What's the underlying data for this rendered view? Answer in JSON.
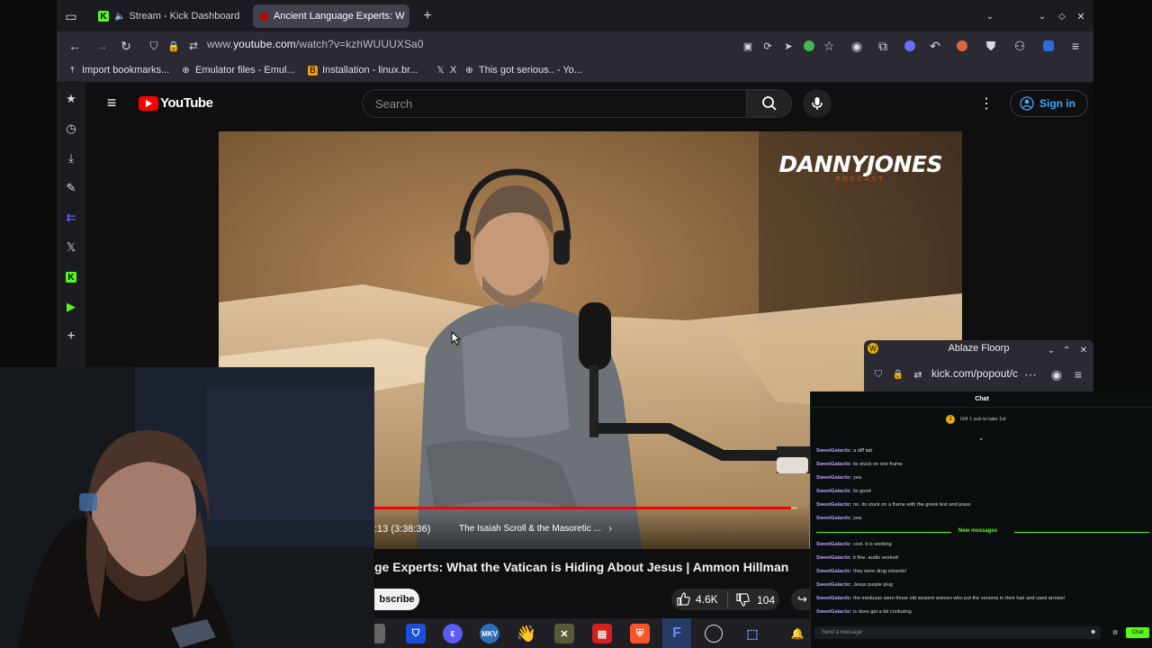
{
  "browser": {
    "tabs": [
      {
        "label": "Stream - Kick Dashboard",
        "favicon": "kick-icon",
        "active": false
      },
      {
        "label": "Ancient Language Experts: W",
        "favicon": "youtube-icon",
        "active": true
      }
    ],
    "url_prefix": "www.",
    "url_domain": "youtube.com",
    "url_rest": "/watch?v=kzhWUUUXSa0",
    "bookmarks": [
      {
        "label": "Import bookmarks...",
        "icon": "import-icon"
      },
      {
        "label": "Emulator files - Emul...",
        "icon": "globe-icon"
      },
      {
        "label": "Installation - linux.br...",
        "icon": "b-icon"
      },
      {
        "label": "X",
        "icon": "x-icon"
      },
      {
        "label": "This got serious.. - Yo...",
        "icon": "globe-icon"
      }
    ]
  },
  "youtube": {
    "logo_text": "YouTube",
    "search_placeholder": "Search",
    "sign_in": "Sign in",
    "video_logo": "DANNYJONES",
    "video_logo_sub": "PODCAST",
    "time_text": ":13 (3:38:36)",
    "chapter": "The Isaiah Scroll & the Masoretic ...",
    "progress_fraction": 0.985,
    "title": "ge Experts: What the Vatican is Hiding About Jesus | Ammon Hillman",
    "subscribe": "bscribe",
    "likes": "4.6K",
    "dislikes": "104"
  },
  "kick_popup": {
    "title": "Ablaze Floorp",
    "url": "kick.com/popout/c"
  },
  "chat": {
    "header": "Chat",
    "pinned": "Gift 1 sub to take 1st",
    "messages_before": [
      {
        "user": "SweetGalactic",
        "text": "a diff tab"
      },
      {
        "user": "SweetGalactic",
        "text": "its stuck on one frame"
      },
      {
        "user": "SweetGalactic",
        "text": "yea"
      },
      {
        "user": "SweetGalactic",
        "text": "its good"
      },
      {
        "user": "SweetGalactic",
        "text": "no. its stuck on a frame with the greek text and jesus"
      },
      {
        "user": "SweetGalactic",
        "text": "yea"
      }
    ],
    "new_messages_label": "New messages",
    "messages_after": [
      {
        "user": "SweetGalactic",
        "text": "cool. it is working"
      },
      {
        "user": "SweetGalactic",
        "text": "it fine. audio worked"
      },
      {
        "user": "SweetGalactic",
        "text": "they were drug wizards!"
      },
      {
        "user": "SweetGalactic",
        "text": "Jesus purple plug"
      },
      {
        "user": "SweetGalactic",
        "text": "the medusas were those old serpent women who put the venoms in their hair and used arrows!"
      },
      {
        "user": "SweetGalactic",
        "text": "is does get a bit confusing"
      }
    ],
    "input_placeholder": "Send a message",
    "send_label": "Chat"
  },
  "colors": {
    "youtube_red": "#ff0000",
    "kick_green": "#53fc18",
    "chat_user": "#b9a6ff",
    "link_blue": "#3ea6ff"
  }
}
